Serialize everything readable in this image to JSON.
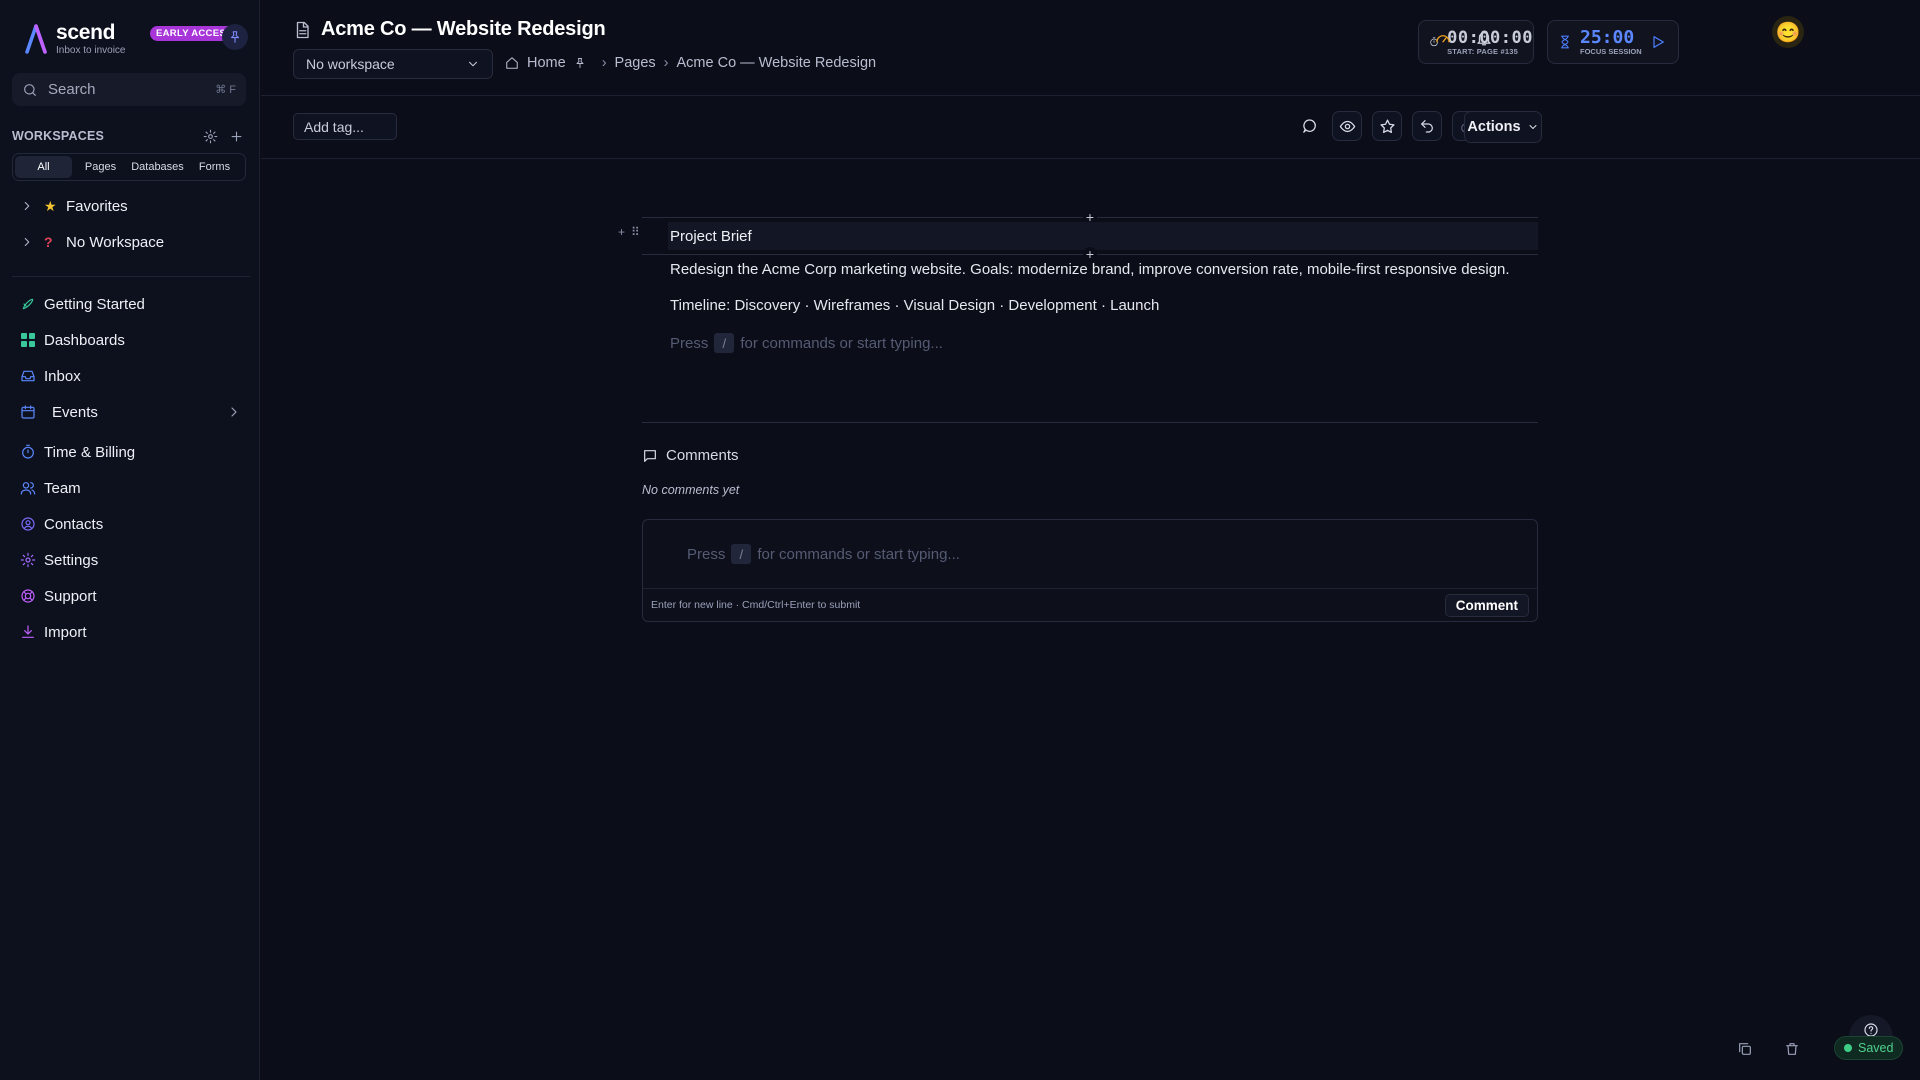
{
  "brand": {
    "name": "scend",
    "tagline": "Inbox to invoice",
    "badge": "EARLY ACCESS",
    "accent": "#a735d8"
  },
  "search": {
    "label": "Search",
    "shortcut": "⌘ F"
  },
  "workspaces": {
    "title": "WORKSPACES",
    "tabs": [
      "All",
      "Pages",
      "Databases",
      "Forms"
    ],
    "active_tab": "All",
    "tree": [
      {
        "label": "Favorites",
        "icon": "star-icon"
      },
      {
        "label": "No Workspace",
        "icon": "question-icon"
      }
    ]
  },
  "nav": [
    {
      "label": "Getting Started",
      "icon": "rocket-icon",
      "color": "#38c89a"
    },
    {
      "label": "Dashboards",
      "icon": "grid-icon",
      "color": "#38c89a"
    },
    {
      "label": "Inbox",
      "icon": "inbox-icon",
      "color": "#5b87ff"
    },
    {
      "label": "Events",
      "icon": "calendar-icon",
      "color": "#5b87ff"
    },
    {
      "label": "Time & Billing",
      "icon": "timer-icon",
      "color": "#5b87ff"
    },
    {
      "label": "Team",
      "icon": "users-icon",
      "color": "#5b87ff"
    },
    {
      "label": "Contacts",
      "icon": "contact-icon",
      "color": "#7b6cff"
    },
    {
      "label": "Settings",
      "icon": "gear-icon",
      "color": "#a06bff"
    },
    {
      "label": "Support",
      "icon": "lifebuoy-icon",
      "color": "#c060ff"
    },
    {
      "label": "Import",
      "icon": "download-icon",
      "color": "#c060ff"
    }
  ],
  "header": {
    "title": "Acme Co — Website Redesign",
    "workspace_select": "No workspace",
    "breadcrumbs": [
      "Home",
      "Pages",
      "Acme Co — Website Redesign"
    ]
  },
  "timer": {
    "value": "00:00:00",
    "sub": "START: PAGE #135"
  },
  "focus": {
    "value": "25:00",
    "sub": "FOCUS SESSION",
    "color": "#5b87ff"
  },
  "toolbar": {
    "tag_placeholder": "Add tag...",
    "actions_label": "Actions"
  },
  "editor": {
    "heading": "Project Brief",
    "paragraphs": [
      "Redesign the Acme Corp marketing website. Goals: modernize brand, improve conversion rate, mobile-first responsive design.",
      "Timeline: Discovery · Wireframes · Visual Design · Development · Launch"
    ],
    "placeholder_pre": "Press",
    "placeholder_key": "/",
    "placeholder_post": "for commands or start typing..."
  },
  "comments": {
    "title": "Comments",
    "empty": "No comments yet",
    "input_pre": "Press",
    "input_key": "/",
    "input_post": "for commands or start typing...",
    "hint": "Enter for new line · Cmd/Ctrl+Enter to submit",
    "submit_label": "Comment"
  },
  "status": {
    "saved_label": "Saved",
    "color": "#3fcf84"
  }
}
